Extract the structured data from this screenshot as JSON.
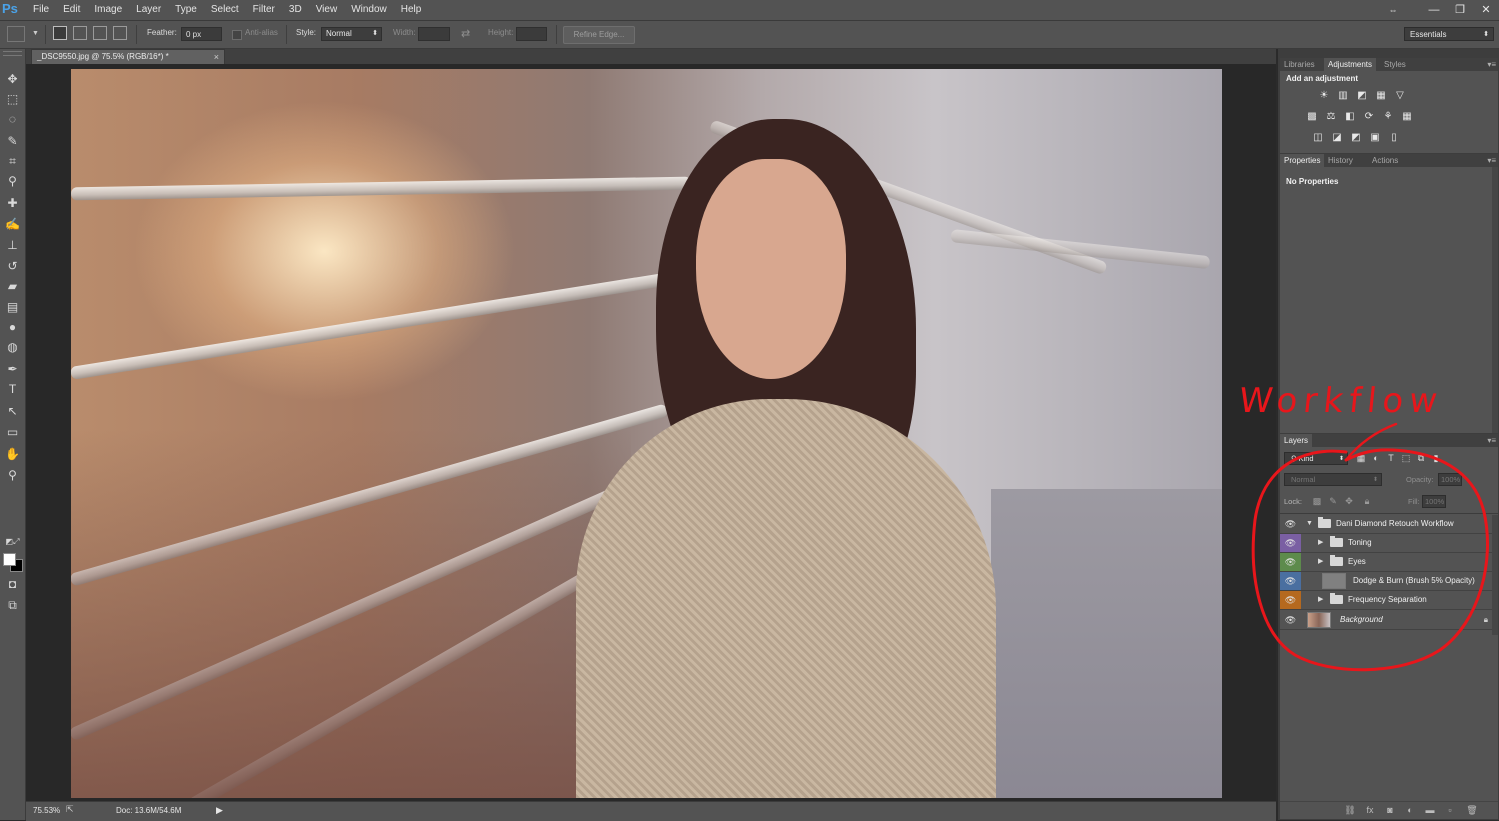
{
  "app": {
    "logo": "Ps"
  },
  "menu": [
    "File",
    "Edit",
    "Image",
    "Layer",
    "Type",
    "Select",
    "Filter",
    "3D",
    "View",
    "Window",
    "Help"
  ],
  "window_controls": {
    "arrows": "⇔",
    "minimize": "—",
    "restore": "❐",
    "close": "✕"
  },
  "options_bar": {
    "feather_label": "Feather:",
    "feather_value": "0 px",
    "antialias_label": "Anti-alias",
    "style_label": "Style:",
    "style_value": "Normal",
    "width_label": "Width:",
    "height_label": "Height:",
    "refine_edge": "Refine Edge...",
    "workspace": "Essentials"
  },
  "document_tab": {
    "title": "_DSC9550.jpg @ 75.5% (RGB/16*) *",
    "close": "×"
  },
  "status_bar": {
    "zoom": "75.53%",
    "doc_size": "Doc: 13.6M/54.6M",
    "arrow": "▶"
  },
  "tools": [
    {
      "name": "move-tool",
      "glyph": "✥"
    },
    {
      "name": "marquee-tool",
      "glyph": "⬚"
    },
    {
      "name": "lasso-tool",
      "glyph": "◌"
    },
    {
      "name": "quick-selection-tool",
      "glyph": "✎"
    },
    {
      "name": "crop-tool",
      "glyph": "⌗"
    },
    {
      "name": "eyedropper-tool",
      "glyph": "⚲"
    },
    {
      "name": "healing-brush-tool",
      "glyph": "✚"
    },
    {
      "name": "brush-tool",
      "glyph": "✍"
    },
    {
      "name": "clone-stamp-tool",
      "glyph": "⊥"
    },
    {
      "name": "history-brush-tool",
      "glyph": "↺"
    },
    {
      "name": "eraser-tool",
      "glyph": "▰"
    },
    {
      "name": "gradient-tool",
      "glyph": "▤"
    },
    {
      "name": "blur-tool",
      "glyph": "●"
    },
    {
      "name": "dodge-tool",
      "glyph": "◍"
    },
    {
      "name": "pen-tool",
      "glyph": "✒"
    },
    {
      "name": "type-tool",
      "glyph": "T"
    },
    {
      "name": "path-selection-tool",
      "glyph": "↖"
    },
    {
      "name": "rectangle-tool",
      "glyph": "▭"
    },
    {
      "name": "hand-tool",
      "glyph": "✋"
    },
    {
      "name": "zoom-tool",
      "glyph": "⚲"
    }
  ],
  "panels": {
    "top_tabs": [
      "Libraries",
      "Adjustments",
      "Styles"
    ],
    "top_active": "Adjustments",
    "add_adjustment": "Add an adjustment",
    "adjustment_icons": [
      [
        "☀",
        "▥",
        "◩",
        "▦",
        "▽"
      ],
      [
        "▩",
        "⚖",
        "◧",
        "⟳",
        "⚘",
        "▦"
      ],
      [
        "◫",
        "◪",
        "◩",
        "▣",
        "▯"
      ]
    ],
    "mid_tabs": [
      "Properties",
      "History",
      "Actions"
    ],
    "mid_active": "Properties",
    "no_properties": "No Properties",
    "layers_tab": "Layers",
    "kind": "Kind",
    "blend_mode": "Normal",
    "opacity_label": "Opacity:",
    "opacity_value": "100%",
    "lock_label": "Lock:",
    "fill_label": "Fill:",
    "fill_value": "100%",
    "layers": [
      {
        "name": "Dani Diamond Retouch Workflow",
        "type": "group",
        "expanded": true,
        "indent": 0,
        "color": ""
      },
      {
        "name": "Toning",
        "type": "group",
        "expanded": false,
        "indent": 1,
        "color": "#7a5fa3"
      },
      {
        "name": "Eyes",
        "type": "group",
        "expanded": false,
        "indent": 1,
        "color": "#5d8b4c"
      },
      {
        "name": "Dodge & Burn (Brush 5% Opacity)",
        "type": "layer",
        "indent": 1,
        "color": "#4a6fa0"
      },
      {
        "name": "Frequency Separation",
        "type": "group",
        "expanded": false,
        "indent": 1,
        "color": "#b5691f"
      },
      {
        "name": "Background",
        "type": "background",
        "indent": 0,
        "color": ""
      }
    ]
  },
  "annotation": {
    "text": "Workflow",
    "color": "#e8161b"
  }
}
